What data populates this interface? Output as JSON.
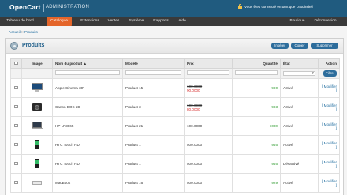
{
  "header": {
    "brand": "OpenCart",
    "subtitle": "ADMINISTRATION",
    "login_text": "Vous êtes connecté en tant que LeoLindell"
  },
  "nav": {
    "left": [
      "Tableau de bord",
      "Catalogue",
      "Extensions",
      "Ventes",
      "Système",
      "Rapports",
      "Aide"
    ],
    "right": [
      "Boutique",
      "Déconnexion"
    ],
    "active": "Catalogue"
  },
  "breadcrumb": {
    "home": "Accueil",
    "separator": "::",
    "current": "Produits"
  },
  "panel": {
    "title": "Produits",
    "buttons": {
      "insert": "Insérer",
      "copy": "Copier",
      "delete": "Supprimer"
    }
  },
  "table": {
    "headers": {
      "image": "Image",
      "name": "Nom du produit",
      "model": "Modèle",
      "price": "Prix",
      "quantity": "Quantité",
      "status": "État",
      "action": "Action"
    },
    "filter_label": "Filtrer",
    "rows": [
      {
        "icon": "monitor-icon",
        "name": "Apple Cinema 30\"",
        "model": "Product 15",
        "price": "100.0000",
        "special": "90.0000",
        "qty": "990",
        "status": "Activé",
        "action": "[ Modifier ]"
      },
      {
        "icon": "camera-icon",
        "name": "Canon EOS 5D",
        "model": "Product 3",
        "price": "100.0000",
        "special": "80.0000",
        "qty": "993",
        "status": "Activé",
        "action": "[ Modifier ]"
      },
      {
        "icon": "laptop-icon",
        "name": "HP LP3065",
        "model": "Product 21",
        "price": "100.0000",
        "special": "",
        "qty": "1000",
        "status": "Activé",
        "action": "[ Modifier ]"
      },
      {
        "icon": "phone-icon",
        "name": "HTC Touch HD",
        "model": "Product 1",
        "price": "500.0000",
        "special": "",
        "qty": "946",
        "status": "Activé",
        "action": "[ Modifier ]"
      },
      {
        "icon": "phone-icon",
        "name": "HTC Touch HD",
        "model": "Product 1",
        "price": "500.0000",
        "special": "",
        "qty": "946",
        "status": "Désactivé",
        "action": "[ Modifier ]"
      },
      {
        "icon": "macbook-icon",
        "name": "MacBook",
        "model": "Product 16",
        "price": "500.0000",
        "special": "",
        "qty": "929",
        "status": "Activé",
        "action": "[ Modifier ]"
      }
    ]
  }
}
